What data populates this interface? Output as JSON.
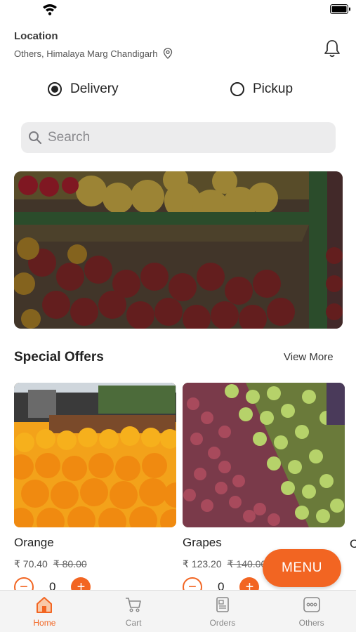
{
  "location": {
    "label": "Location",
    "value": "Others, Himalaya Marg Chandigarh"
  },
  "order_type": {
    "options": [
      {
        "label": "Delivery",
        "selected": true
      },
      {
        "label": "Pickup",
        "selected": false
      }
    ]
  },
  "search": {
    "placeholder": "Search"
  },
  "special_offers": {
    "title": "Special Offers",
    "view_more": "View More",
    "items": [
      {
        "name": "Orange",
        "price": "₹ 70.40",
        "old_price": "₹ 80.00",
        "qty": "0"
      },
      {
        "name": "Grapes",
        "price": "₹ 123.20",
        "old_price": "₹ 140.00",
        "qty": "0"
      }
    ],
    "next_item_initial": "C"
  },
  "menu_button": {
    "label": "MENU"
  },
  "tabbar": {
    "tabs": [
      {
        "label": "Home",
        "icon": "home-icon",
        "active": true
      },
      {
        "label": "Cart",
        "icon": "cart-icon",
        "active": false
      },
      {
        "label": "Orders",
        "icon": "orders-icon",
        "active": false
      },
      {
        "label": "Others",
        "icon": "more-icon",
        "active": false
      }
    ]
  },
  "colors": {
    "accent": "#f26522",
    "tab_inactive": "#888888",
    "search_bg": "#ececed"
  }
}
